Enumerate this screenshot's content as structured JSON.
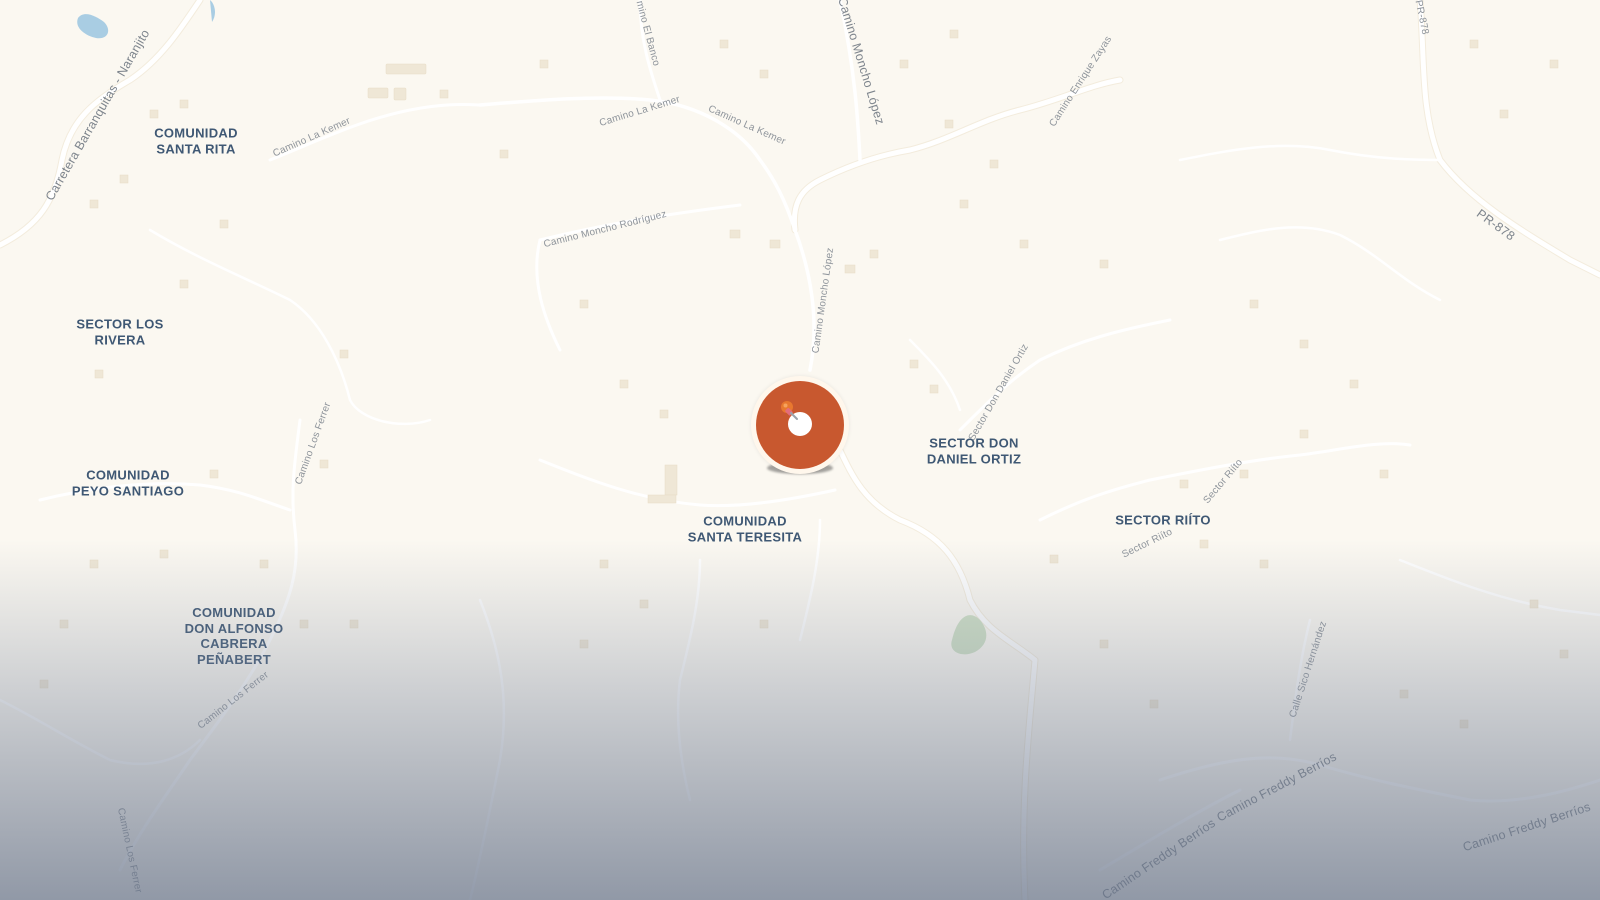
{
  "map": {
    "place_labels": [
      {
        "id": "santa-rita",
        "text": "COMUNIDAD\nSANTA RITA"
      },
      {
        "id": "los-rivera",
        "text": "SECTOR LOS\nRIVERA"
      },
      {
        "id": "peyo-santiago",
        "text": "COMUNIDAD\nPEYO SANTIAGO"
      },
      {
        "id": "don-alfonso",
        "text": "COMUNIDAD\nDON ALFONSO\nCABRERA\nPEÑABERT"
      },
      {
        "id": "santa-teresita",
        "text": "COMUNIDAD\nSANTA TERESITA"
      },
      {
        "id": "don-daniel-ortiz",
        "text": "SECTOR DON\nDANIEL ORTIZ"
      },
      {
        "id": "riito",
        "text": "SECTOR RIÍTO"
      }
    ],
    "road_labels": [
      {
        "id": "carretera-barranquitas",
        "text": "Carretera Barranquitas - Naranjito"
      },
      {
        "id": "camino-la-kemer-1",
        "text": "Camino La Kemer"
      },
      {
        "id": "camino-la-kemer-2",
        "text": "Camino La Kemer"
      },
      {
        "id": "camino-la-kemer-3",
        "text": "Camino La Kemer"
      },
      {
        "id": "camino-el-banco",
        "text": "mino El Banco"
      },
      {
        "id": "camino-moncho-lopez-1",
        "text": "Camino Moncho López"
      },
      {
        "id": "camino-moncho-lopez-2",
        "text": "Camino Moncho López"
      },
      {
        "id": "camino-enrique-zayas",
        "text": "Camino Enrique Zayas"
      },
      {
        "id": "camino-moncho-rodriguez",
        "text": "Camino Moncho Rodríguez"
      },
      {
        "id": "pr-878-top",
        "text": "PR-878"
      },
      {
        "id": "pr-878-right",
        "text": "PR-878"
      },
      {
        "id": "camino-los-ferrer-1",
        "text": "Camino Los Ferrer"
      },
      {
        "id": "camino-los-ferrer-2",
        "text": "Camino Los Ferrer"
      },
      {
        "id": "camino-los-ferrer-3",
        "text": "Camino Los Ferrer"
      },
      {
        "id": "sector-don-daniel-ortiz-road",
        "text": "Sector Don Daniel Ortiz"
      },
      {
        "id": "sector-riito-road-1",
        "text": "Sector Riíto"
      },
      {
        "id": "sector-riito-road-2",
        "text": "Sector Riíto"
      },
      {
        "id": "calle-sico-hernandez",
        "text": "Calle Sico Hernández"
      },
      {
        "id": "camino-freddy-berrios-1",
        "text": "Camino Freddy Berríos"
      },
      {
        "id": "camino-freddy-berrios-2",
        "text": "Camino Freddy Berríos"
      },
      {
        "id": "camino-freddy-berrios-3",
        "text": "Camino Freddy Berríos"
      }
    ],
    "marker": {
      "icon": "pushpin-icon",
      "color": "#c8582f"
    }
  }
}
